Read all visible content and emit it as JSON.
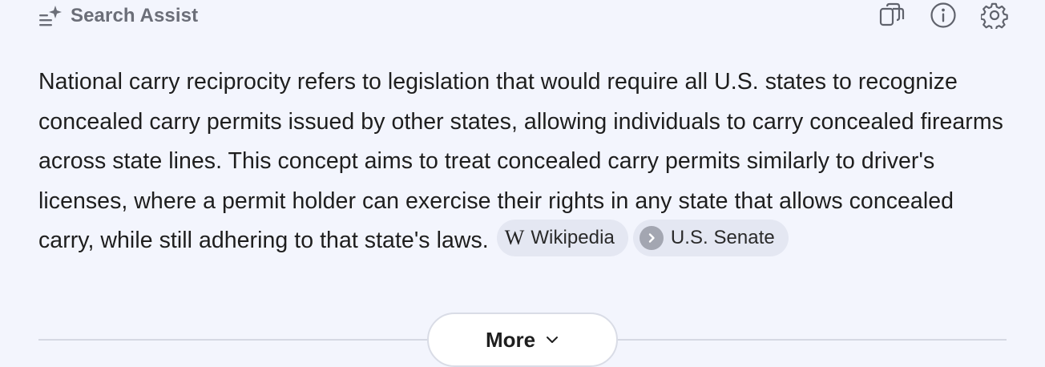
{
  "header": {
    "title": "Search Assist",
    "icon": "sparkle-list-icon"
  },
  "actions": [
    {
      "name": "copy-icon",
      "label": "Copy"
    },
    {
      "name": "info-icon",
      "label": "Info"
    },
    {
      "name": "gear-icon",
      "label": "Settings"
    }
  ],
  "answer": {
    "text": "National carry reciprocity refers to legislation that would require all U.S. states to recognize concealed carry permits issued by other states, allowing individuals to carry concealed firearms across state lines. This concept aims to treat concealed carry permits similarly to driver's licenses, where a permit holder can exercise their rights in any state that allows concealed carry, while still adhering to that state's laws."
  },
  "sources": [
    {
      "label": "Wikipedia",
      "icon": "wikipedia-w-icon"
    },
    {
      "label": "U.S. Senate",
      "icon": "chevron-right-circle-icon"
    }
  ],
  "more_button": {
    "label": "More",
    "icon": "chevron-down-icon"
  },
  "colors": {
    "background": "#f3f5fd",
    "chip_bg": "#e4e7f2",
    "title": "#6b6e78",
    "text": "#1e1e1e"
  }
}
